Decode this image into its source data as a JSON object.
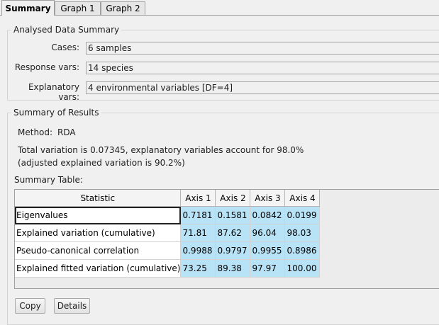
{
  "tabs": [
    "Summary",
    "Graph 1",
    "Graph 2"
  ],
  "analysed": {
    "title": "Analysed Data Summary",
    "rows": [
      {
        "label": "Cases:",
        "value": "6 samples"
      },
      {
        "label": "Response vars:",
        "value": "14 species"
      },
      {
        "label": "Explanatory vars:",
        "value": "4 environmental variables [DF=4]"
      }
    ]
  },
  "results": {
    "title": "Summary of Results",
    "method_label": "Method:",
    "method_value": "RDA",
    "variation_line1": "Total variation is 0.07345, explanatory variables account for  98.0%",
    "variation_line2": "(adjusted explained variation is  90.2%)",
    "table_title": "Summary Table:"
  },
  "table": {
    "headers": [
      "Statistic",
      "Axis 1",
      "Axis 2",
      "Axis 3",
      "Axis 4"
    ],
    "rows": [
      [
        "Eigenvalues",
        "0.7181",
        "0.1581",
        "0.0842",
        "0.0199"
      ],
      [
        "Explained variation (cumulative)",
        "71.81",
        "87.62",
        "96.04",
        "98.03"
      ],
      [
        "Pseudo-canonical correlation",
        "0.9988",
        "0.9797",
        "0.9955",
        "0.8986"
      ],
      [
        "Explained fitted variation (cumulative)",
        "73.25",
        "89.38",
        "97.97",
        "100.00"
      ]
    ]
  },
  "buttons": {
    "copy": "Copy",
    "details": "Details"
  }
}
